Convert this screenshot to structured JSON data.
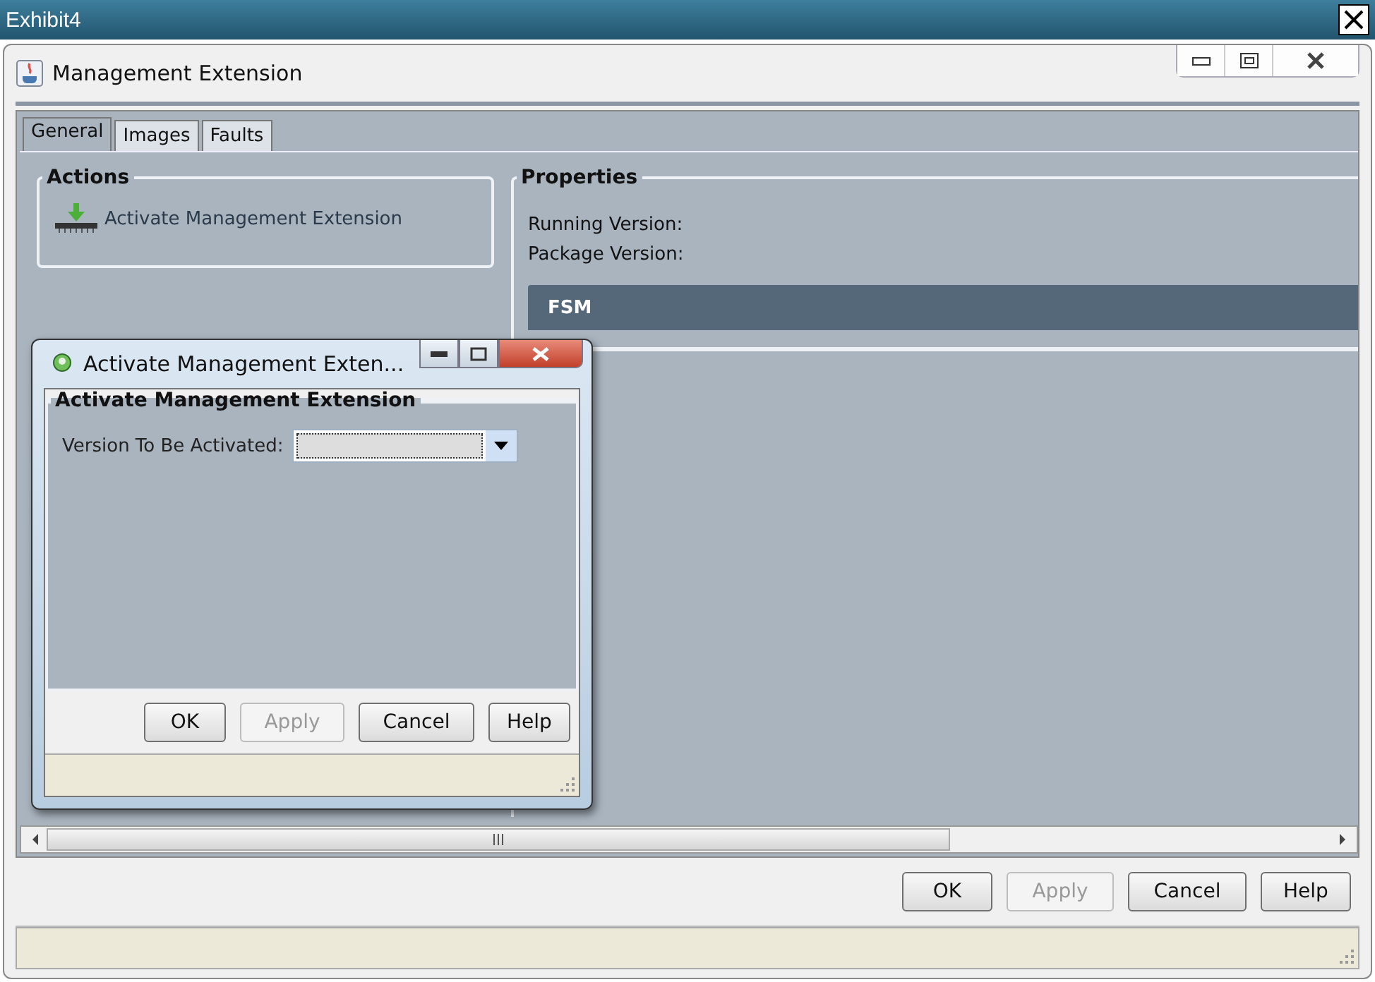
{
  "frame": {
    "title": "Exhibit4"
  },
  "window": {
    "title": "Management Extension"
  },
  "tabs": [
    {
      "label": "General",
      "selected": true
    },
    {
      "label": "Images",
      "selected": false
    },
    {
      "label": "Faults",
      "selected": false
    }
  ],
  "actions": {
    "title": "Actions",
    "items": [
      "Activate Management Extension"
    ]
  },
  "properties": {
    "title": "Properties",
    "fields": [
      "Running Version:",
      "Package Version:"
    ],
    "section": "FSM"
  },
  "buttons": [
    {
      "label": "OK",
      "disabled": false
    },
    {
      "label": "Apply",
      "disabled": true
    },
    {
      "label": "Cancel",
      "disabled": false
    },
    {
      "label": "Help",
      "disabled": false
    }
  ],
  "dialog": {
    "title": "Activate Management Exten...",
    "group": "Activate Management Extension",
    "field_label": "Version To Be Activated:",
    "buttons": [
      {
        "label": "OK",
        "disabled": false
      },
      {
        "label": "Apply",
        "disabled": true
      },
      {
        "label": "Cancel",
        "disabled": false
      },
      {
        "label": "Help",
        "disabled": false
      }
    ]
  }
}
